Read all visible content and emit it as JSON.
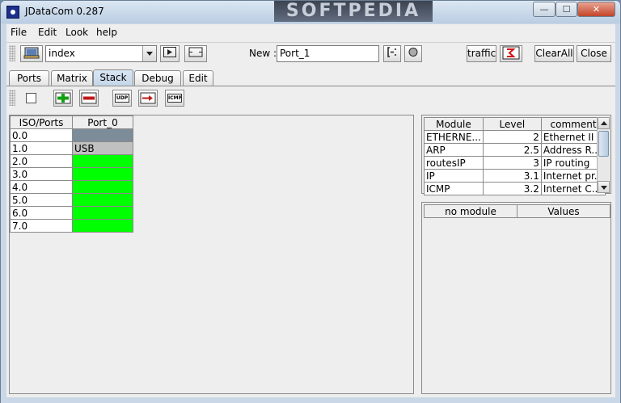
{
  "window": {
    "title": "JDataCom 0.287",
    "watermark": "SOFTPEDIA",
    "controls": {
      "minimize": "—",
      "maximize": "☐",
      "close": "✕"
    }
  },
  "menu": [
    "File",
    "Edit",
    "Look",
    "help"
  ],
  "toolbar": {
    "combo_value": "index",
    "new_label": "New :",
    "new_value": "Port_1",
    "traffic_label": "traffic",
    "clear_all_label": "ClearAll",
    "close_label": "Close"
  },
  "tabs": [
    {
      "label": "Ports",
      "active": false
    },
    {
      "label": "Matrix",
      "active": false
    },
    {
      "label": "Stack",
      "active": true
    },
    {
      "label": "Debug",
      "active": false
    },
    {
      "label": "Edit",
      "active": false
    }
  ],
  "stack_buttons": {
    "udp": "UDP",
    "icmp": "ICMP"
  },
  "ports_grid": {
    "headers": [
      "ISO/Ports",
      "Port_0"
    ],
    "rows": [
      {
        "iso": "0.0",
        "value": "",
        "color": "#7d8c99"
      },
      {
        "iso": "1.0",
        "value": "USB",
        "color": "#c0c0c0"
      },
      {
        "iso": "2.0",
        "value": "",
        "color": "#00ff00"
      },
      {
        "iso": "3.0",
        "value": "",
        "color": "#00ff00"
      },
      {
        "iso": "4.0",
        "value": "",
        "color": "#00ff00"
      },
      {
        "iso": "5.0",
        "value": "",
        "color": "#00ff00"
      },
      {
        "iso": "6.0",
        "value": "",
        "color": "#00ff00"
      },
      {
        "iso": "7.0",
        "value": "",
        "color": "#00ff00"
      }
    ]
  },
  "module_table": {
    "headers": [
      "Module",
      "Level",
      "comment"
    ],
    "rows": [
      [
        "ETHERNE...",
        "2",
        "Ethernet II"
      ],
      [
        "ARP",
        "2.5",
        "Address R..."
      ],
      [
        "routesIP",
        "3",
        "IP routing"
      ],
      [
        "IP",
        "3.1",
        "Internet pr..."
      ],
      [
        "ICMP",
        "3.2",
        "Internet C..."
      ]
    ]
  },
  "values_table": {
    "headers": [
      "no module",
      "Values"
    ]
  }
}
